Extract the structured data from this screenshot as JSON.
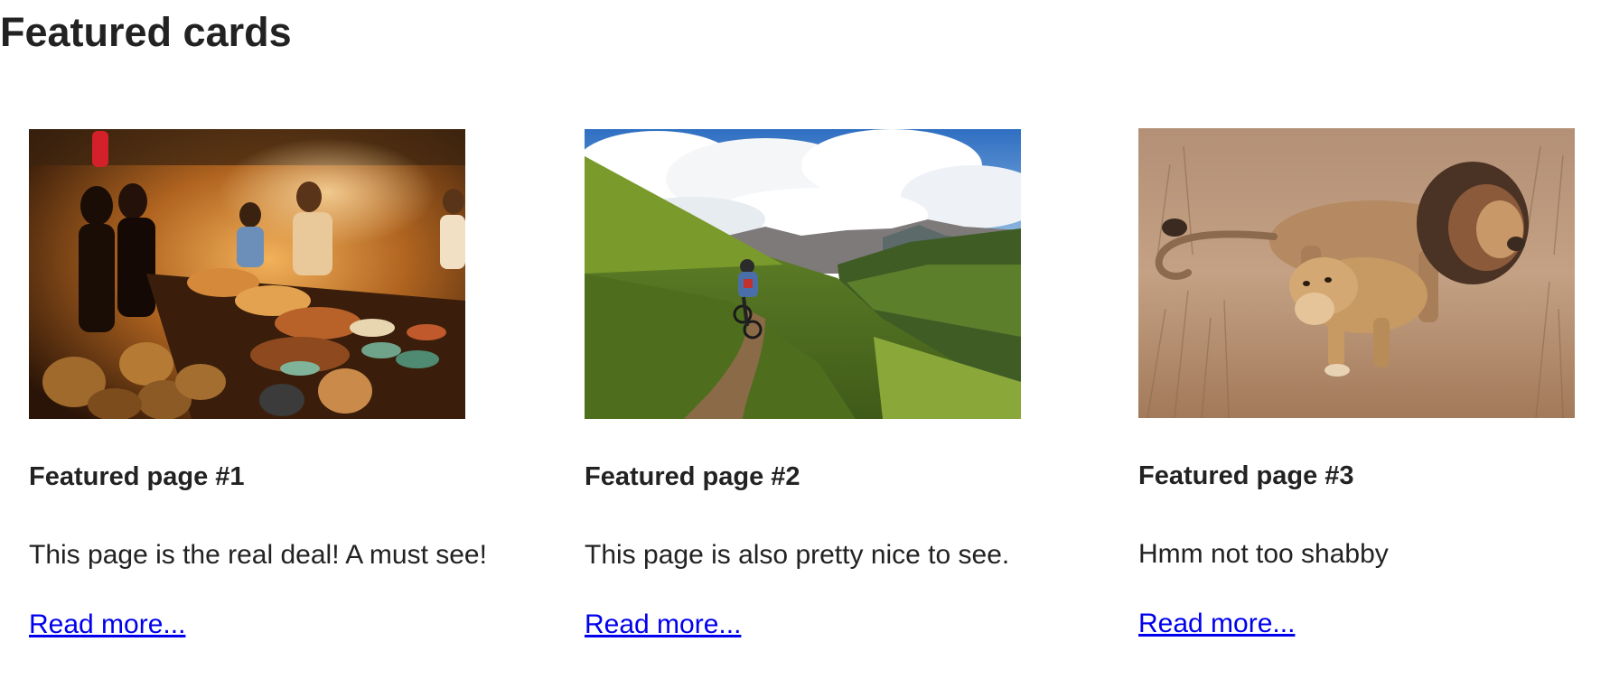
{
  "page": {
    "title": "Featured cards"
  },
  "cards": [
    {
      "image": "photo of a busy market food stall kitchen",
      "title": "Featured page #1",
      "description": "This page is the real deal! A must see!",
      "link": "Read more..."
    },
    {
      "image": "photo of a mountain biker on a valley trail",
      "title": "Featured page #2",
      "description": "This page is also pretty nice to see.",
      "link": "Read more..."
    },
    {
      "image": "photo of a lion and lioness in tall grass",
      "title": "Featured page #3",
      "description": "Hmm not too shabby",
      "link": "Read more..."
    }
  ],
  "colors": {
    "link": "#0000ee",
    "text": "#222222",
    "background": "#ffffff"
  }
}
